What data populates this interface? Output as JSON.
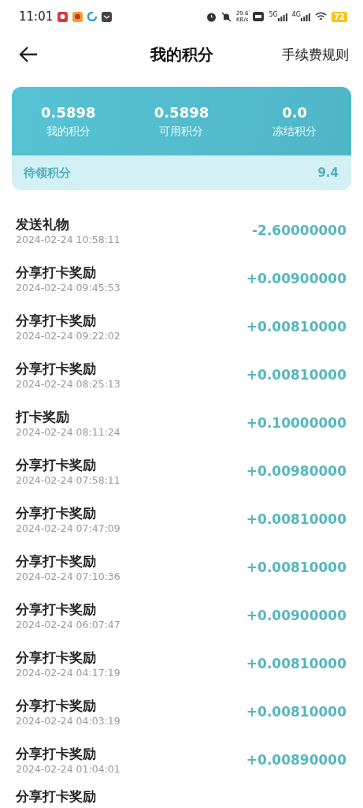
{
  "status_bar": {
    "time": "11:01",
    "net_speed": "29.6",
    "net_unit": "KB/s",
    "signal_1": "5G",
    "signal_2": "4G",
    "battery": "72"
  },
  "header": {
    "title": "我的积分",
    "action": "手续费规则"
  },
  "summary": {
    "stats": [
      {
        "value": "0.5898",
        "label": "我的积分"
      },
      {
        "value": "0.5898",
        "label": "可用积分"
      },
      {
        "value": "0.0",
        "label": "冻结积分"
      }
    ],
    "pending": {
      "label": "待领积分",
      "value": "9.4"
    }
  },
  "records": [
    {
      "title": "发送礼物",
      "time": "2024-02-24 10:58:11",
      "amount": "-2.60000000"
    },
    {
      "title": "分享打卡奖励",
      "time": "2024-02-24 09:45:53",
      "amount": "+0.00900000"
    },
    {
      "title": "分享打卡奖励",
      "time": "2024-02-24 09:22:02",
      "amount": "+0.00810000"
    },
    {
      "title": "分享打卡奖励",
      "time": "2024-02-24 08:25:13",
      "amount": "+0.00810000"
    },
    {
      "title": "打卡奖励",
      "time": "2024-02-24 08:11:24",
      "amount": "+0.10000000"
    },
    {
      "title": "分享打卡奖励",
      "time": "2024-02-24 07:58:11",
      "amount": "+0.00980000"
    },
    {
      "title": "分享打卡奖励",
      "time": "2024-02-24 07:47:09",
      "amount": "+0.00810000"
    },
    {
      "title": "分享打卡奖励",
      "time": "2024-02-24 07:10:36",
      "amount": "+0.00810000"
    },
    {
      "title": "分享打卡奖励",
      "time": "2024-02-24 06:07:47",
      "amount": "+0.00900000"
    },
    {
      "title": "分享打卡奖励",
      "time": "2024-02-24 04:17:19",
      "amount": "+0.00810000"
    },
    {
      "title": "分享打卡奖励",
      "time": "2024-02-24 04:03:19",
      "amount": "+0.00810000"
    },
    {
      "title": "分享打卡奖励",
      "time": "2024-02-24 01:04:01",
      "amount": "+0.00890000"
    },
    {
      "title": "分享打卡奖励"
    }
  ]
}
